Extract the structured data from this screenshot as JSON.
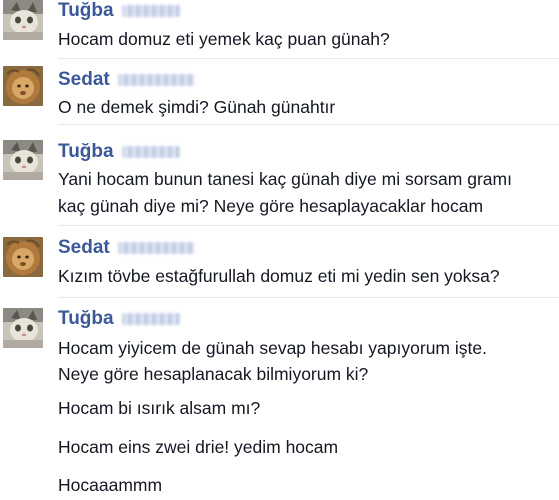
{
  "chat": {
    "messages": [
      {
        "sender": "Tuğba",
        "avatar": "cat-photo-avatar",
        "lines": [
          "Hocam domuz eti yemek kaç puan günah?"
        ]
      },
      {
        "sender": "Sedat",
        "avatar": "lion-photo-avatar",
        "lines": [
          "O ne demek şimdi? Günah günahtır"
        ]
      },
      {
        "sender": "Tuğba",
        "avatar": "cat-photo-avatar",
        "lines": [
          "Yani hocam bunun tanesi kaç günah diye mi sorsam gramı",
          "kaç günah diye mi? Neye göre hesaplayacaklar hocam"
        ]
      },
      {
        "sender": "Sedat",
        "avatar": "lion-photo-avatar",
        "lines": [
          "Kızım tövbe estağfurullah domuz eti mi yedin sen yoksa?"
        ]
      },
      {
        "sender": "Tuğba",
        "avatar": "cat-photo-avatar",
        "lines": [
          "Hocam yiyicem de günah sevap hesabı yapıyorum işte.",
          "Neye göre hesaplanacak bilmiyorum ki?",
          "Hocam bi ısırık alsam mı?",
          "Hocam eins zwei drie! yedim hocam",
          "Hocaaammm"
        ]
      }
    ]
  },
  "colors": {
    "sender_name": "#3b5998",
    "message_text": "#141823",
    "background": "#ffffff"
  }
}
